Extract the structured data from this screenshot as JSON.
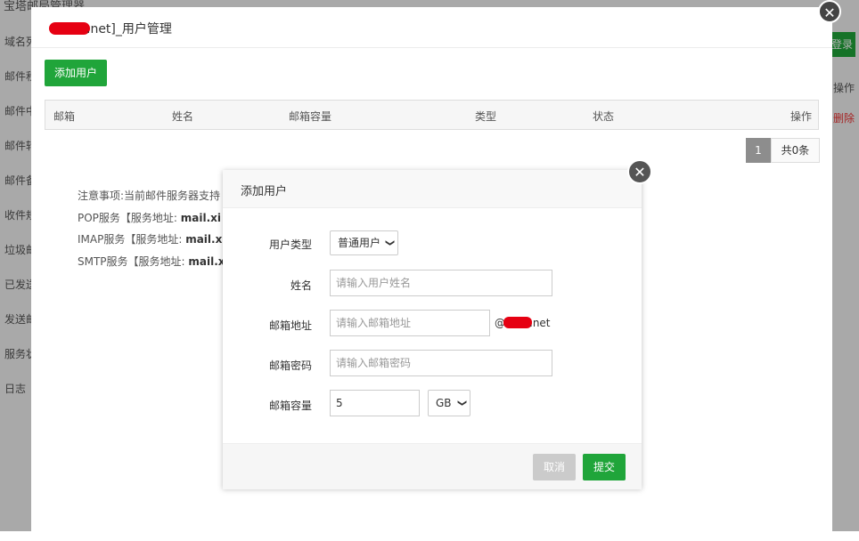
{
  "background": {
    "app_title": "宝塔邮局管理器",
    "nav_items": [
      "域名列表",
      "邮件积压",
      "邮件中继",
      "邮件转发",
      "邮件备份",
      "收件规则",
      "垃圾邮件",
      "已发送",
      "发送邮件",
      "服务状态",
      "日志"
    ],
    "right_button": "登录",
    "right_op_header": "操作",
    "right_delete": "删除"
  },
  "window": {
    "title_suffix": ".net]_用户管理",
    "close_glyph": "✕",
    "add_user_label": "添加用户",
    "table_headers": [
      "邮箱",
      "姓名",
      "邮箱容量",
      "类型",
      "状态",
      "操作"
    ],
    "pagination": {
      "current_page": "1",
      "total_text": "共0条"
    },
    "notes": [
      {
        "prefix": "注意事项:当前邮件服务器支持",
        "bold": ""
      },
      {
        "prefix": "POP服务【服务地址: ",
        "bold": "mail.xi"
      },
      {
        "prefix": "IMAP服务【服务地址: ",
        "bold": "mail.x"
      },
      {
        "prefix": "SMTP服务【服务地址: ",
        "bold": "mail.x"
      }
    ]
  },
  "dialog": {
    "title": "添加用户",
    "close_glyph": "✕",
    "fields": {
      "user_type": {
        "label": "用户类型",
        "selected": "普通用户"
      },
      "name": {
        "label": "姓名",
        "placeholder": "请输入用户姓名",
        "value": ""
      },
      "email": {
        "label": "邮箱地址",
        "placeholder": "请输入邮箱地址",
        "value": "",
        "suffix_at": "@",
        "suffix_tld": ".net"
      },
      "password": {
        "label": "邮箱密码",
        "placeholder": "请输入邮箱密码",
        "value": ""
      },
      "quota": {
        "label": "邮箱容量",
        "value": "5",
        "unit": "GB"
      }
    },
    "cancel_label": "取消",
    "submit_label": "提交"
  },
  "colors": {
    "primary_green": "#20a53a",
    "redaction_red": "#e60012",
    "cancel_gray": "#cbcbcb"
  }
}
